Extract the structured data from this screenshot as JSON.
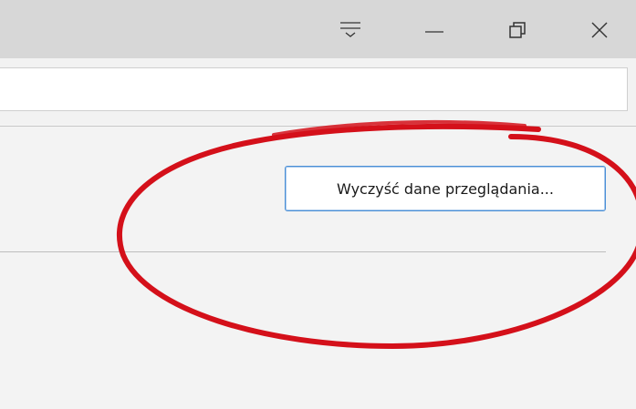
{
  "window": {
    "controls": {
      "menu_icon": "hub-menu-icon",
      "minimize_icon": "minimize-icon",
      "maximize_icon": "restore-icon",
      "close_icon": "close-icon"
    }
  },
  "address_bar": {
    "value": "",
    "placeholder": ""
  },
  "settings": {
    "clear_browsing_data_label": "Wyczyść dane przeglądania..."
  },
  "annotation": {
    "shape": "ellipse",
    "color": "#d4101a"
  },
  "colors": {
    "titlebar": "#d7d7d7",
    "content_bg": "#f3f3f3",
    "button_border": "#4a8fd6"
  }
}
